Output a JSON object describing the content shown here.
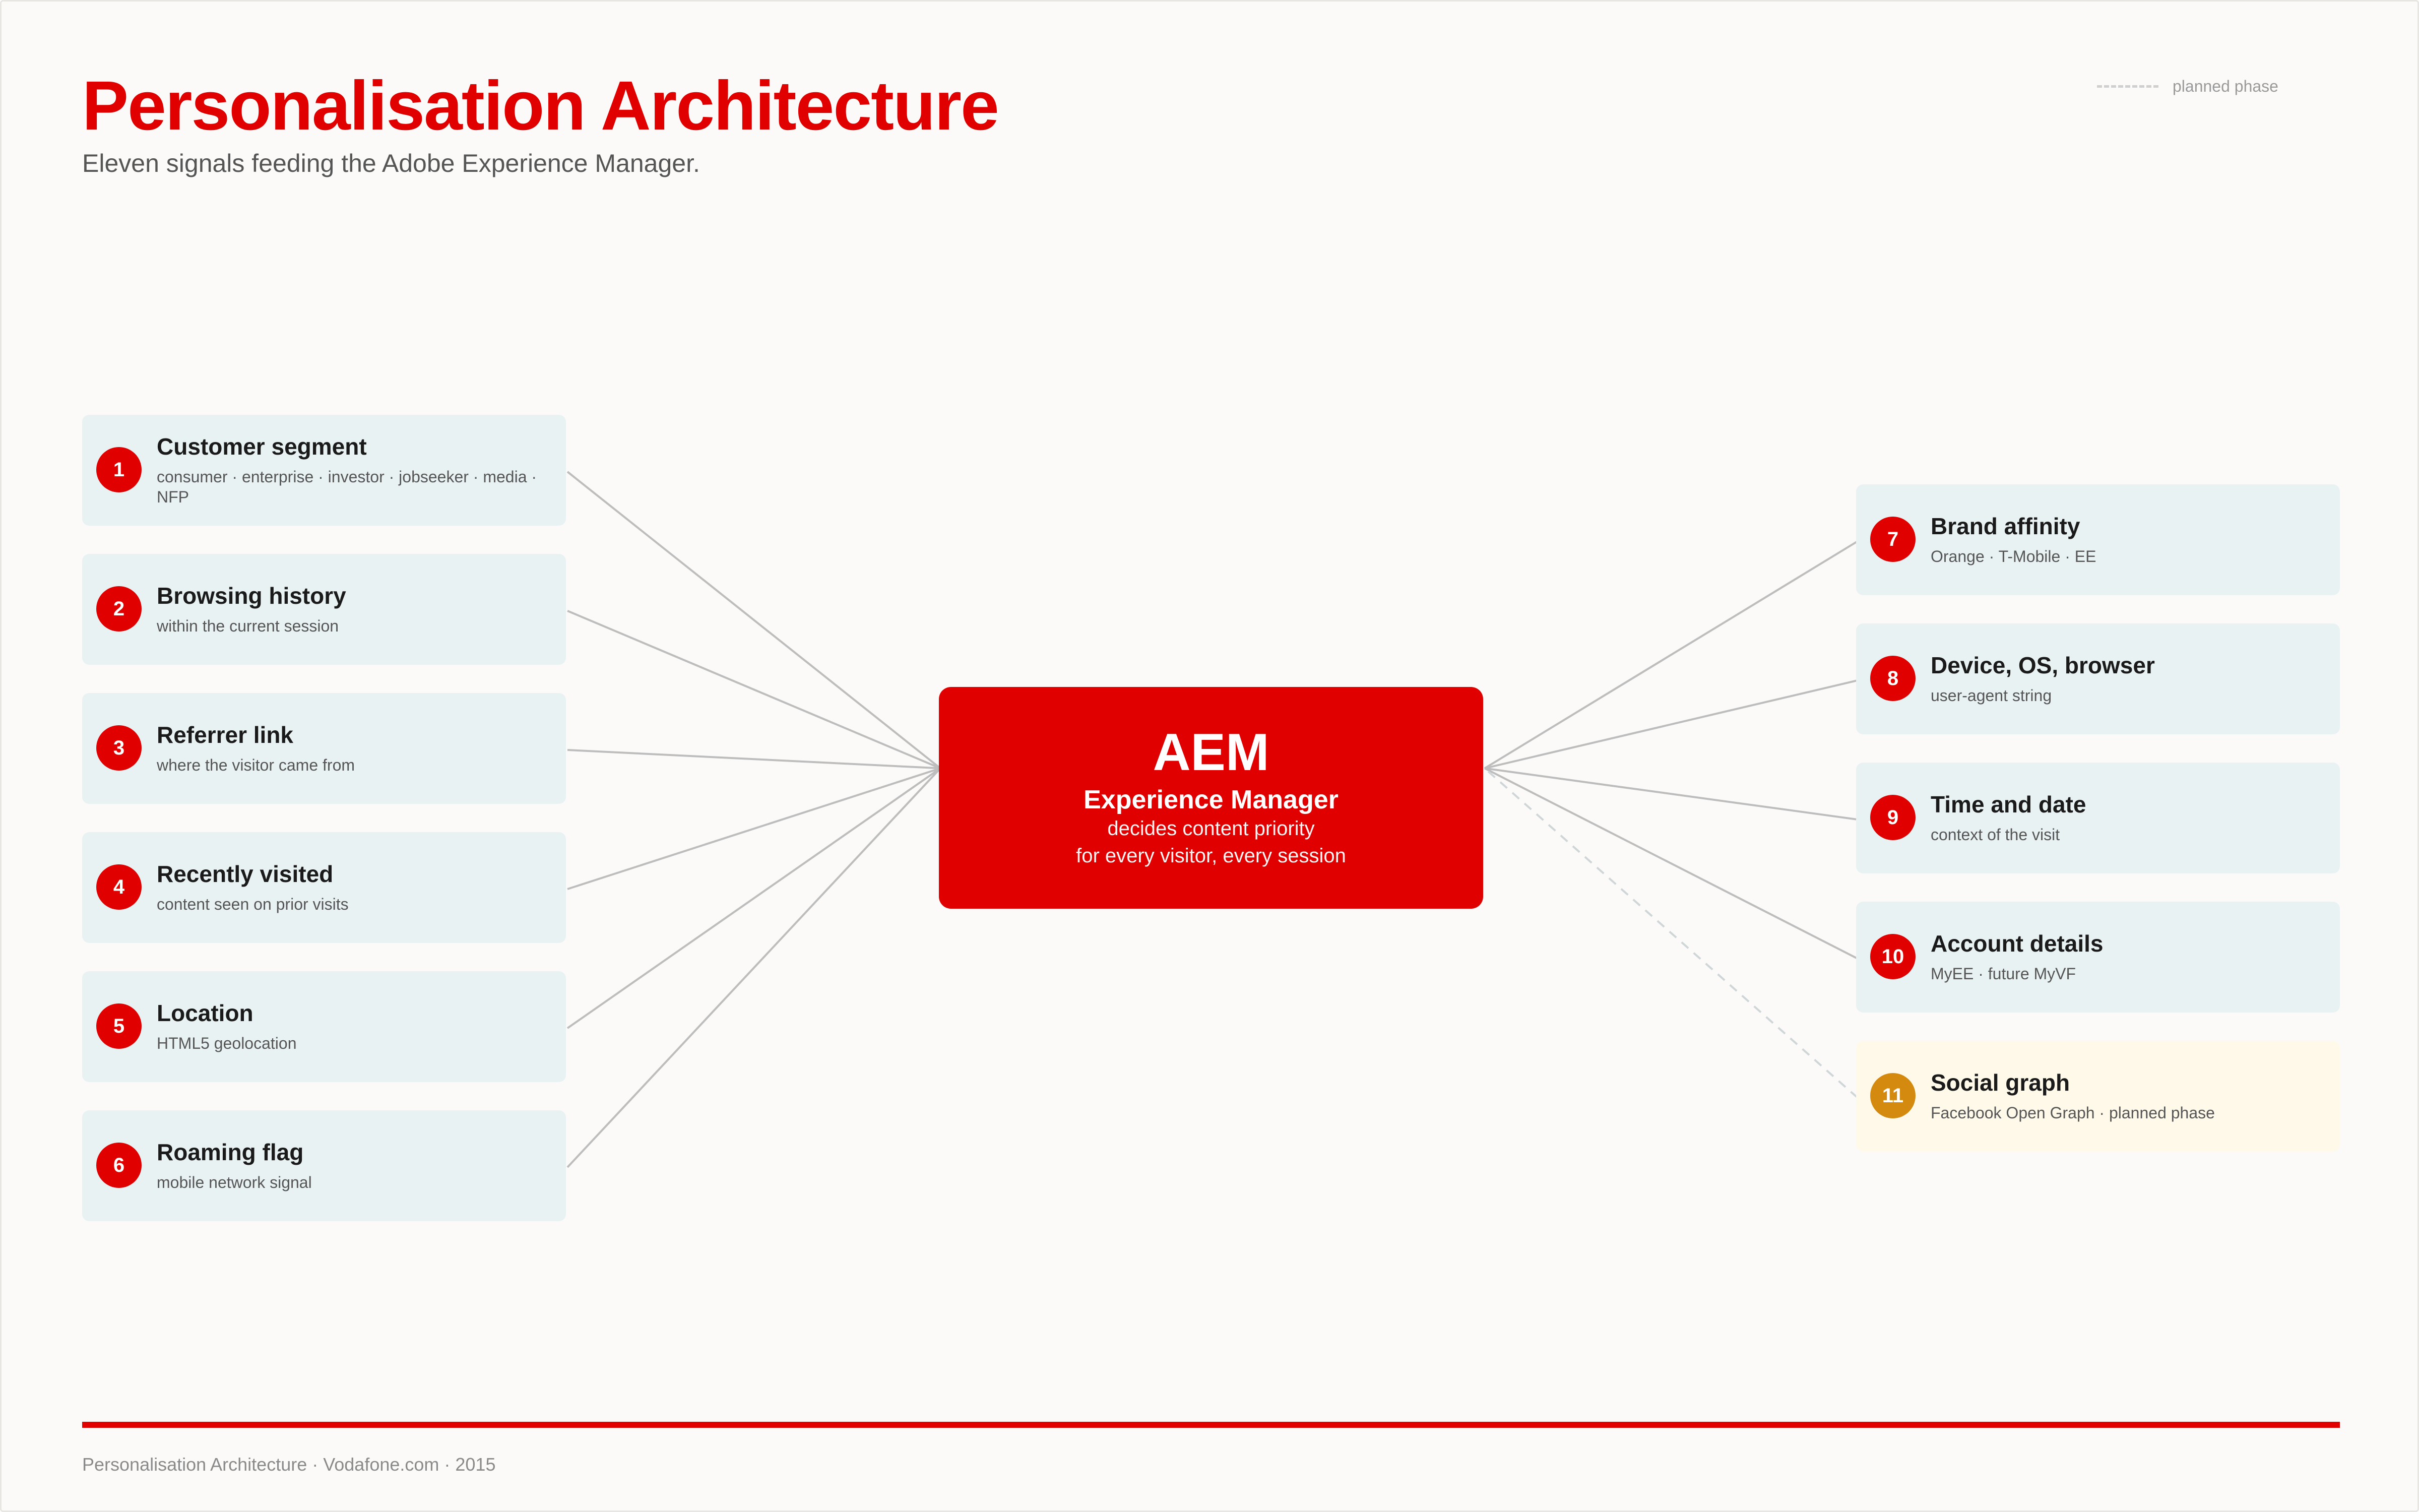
{
  "header": {
    "title": "Personalisation Architecture",
    "subtitle": "Eleven signals feeding the Adobe Experience Manager."
  },
  "legend": {
    "label": "planned phase"
  },
  "hub": {
    "title": "AEM",
    "subtitle": "Experience Manager",
    "line1": "decides content priority",
    "line2": "for every visitor, every session"
  },
  "signals": [
    {
      "number": "1",
      "title": "Customer segment",
      "desc": "consumer · enterprise · investor · jobseeker · media · NFP",
      "side": "left",
      "planned": false
    },
    {
      "number": "2",
      "title": "Browsing history",
      "desc": "within the current session",
      "side": "left",
      "planned": false
    },
    {
      "number": "3",
      "title": "Referrer link",
      "desc": "where the visitor came from",
      "side": "left",
      "planned": false
    },
    {
      "number": "4",
      "title": "Recently visited",
      "desc": "content seen on prior visits",
      "side": "left",
      "planned": false
    },
    {
      "number": "5",
      "title": "Location",
      "desc": "HTML5 geolocation",
      "side": "left",
      "planned": false
    },
    {
      "number": "6",
      "title": "Roaming flag",
      "desc": "mobile network signal",
      "side": "left",
      "planned": false
    },
    {
      "number": "7",
      "title": "Brand affinity",
      "desc": "Orange · T-Mobile · EE",
      "side": "right",
      "planned": false
    },
    {
      "number": "8",
      "title": "Device, OS, browser",
      "desc": "user-agent string",
      "side": "right",
      "planned": false
    },
    {
      "number": "9",
      "title": "Time and date",
      "desc": "context of the visit",
      "side": "right",
      "planned": false
    },
    {
      "number": "10",
      "title": "Account details",
      "desc": "MyEE · future MyVF",
      "side": "right",
      "planned": false
    },
    {
      "number": "11",
      "title": "Social graph",
      "desc": "Facebook Open Graph · planned phase",
      "side": "right",
      "planned": true
    }
  ],
  "colors": {
    "accent": "#e00000",
    "planned_badge": "#d48a0f",
    "node_bg": "#e9f2f3",
    "planned_bg": "#fff9ea",
    "connector": "#bdbdbd",
    "planned_connector": "#cfd6d8"
  },
  "footer": {
    "text": "Personalisation Architecture · Vodafone.com · 2015"
  }
}
